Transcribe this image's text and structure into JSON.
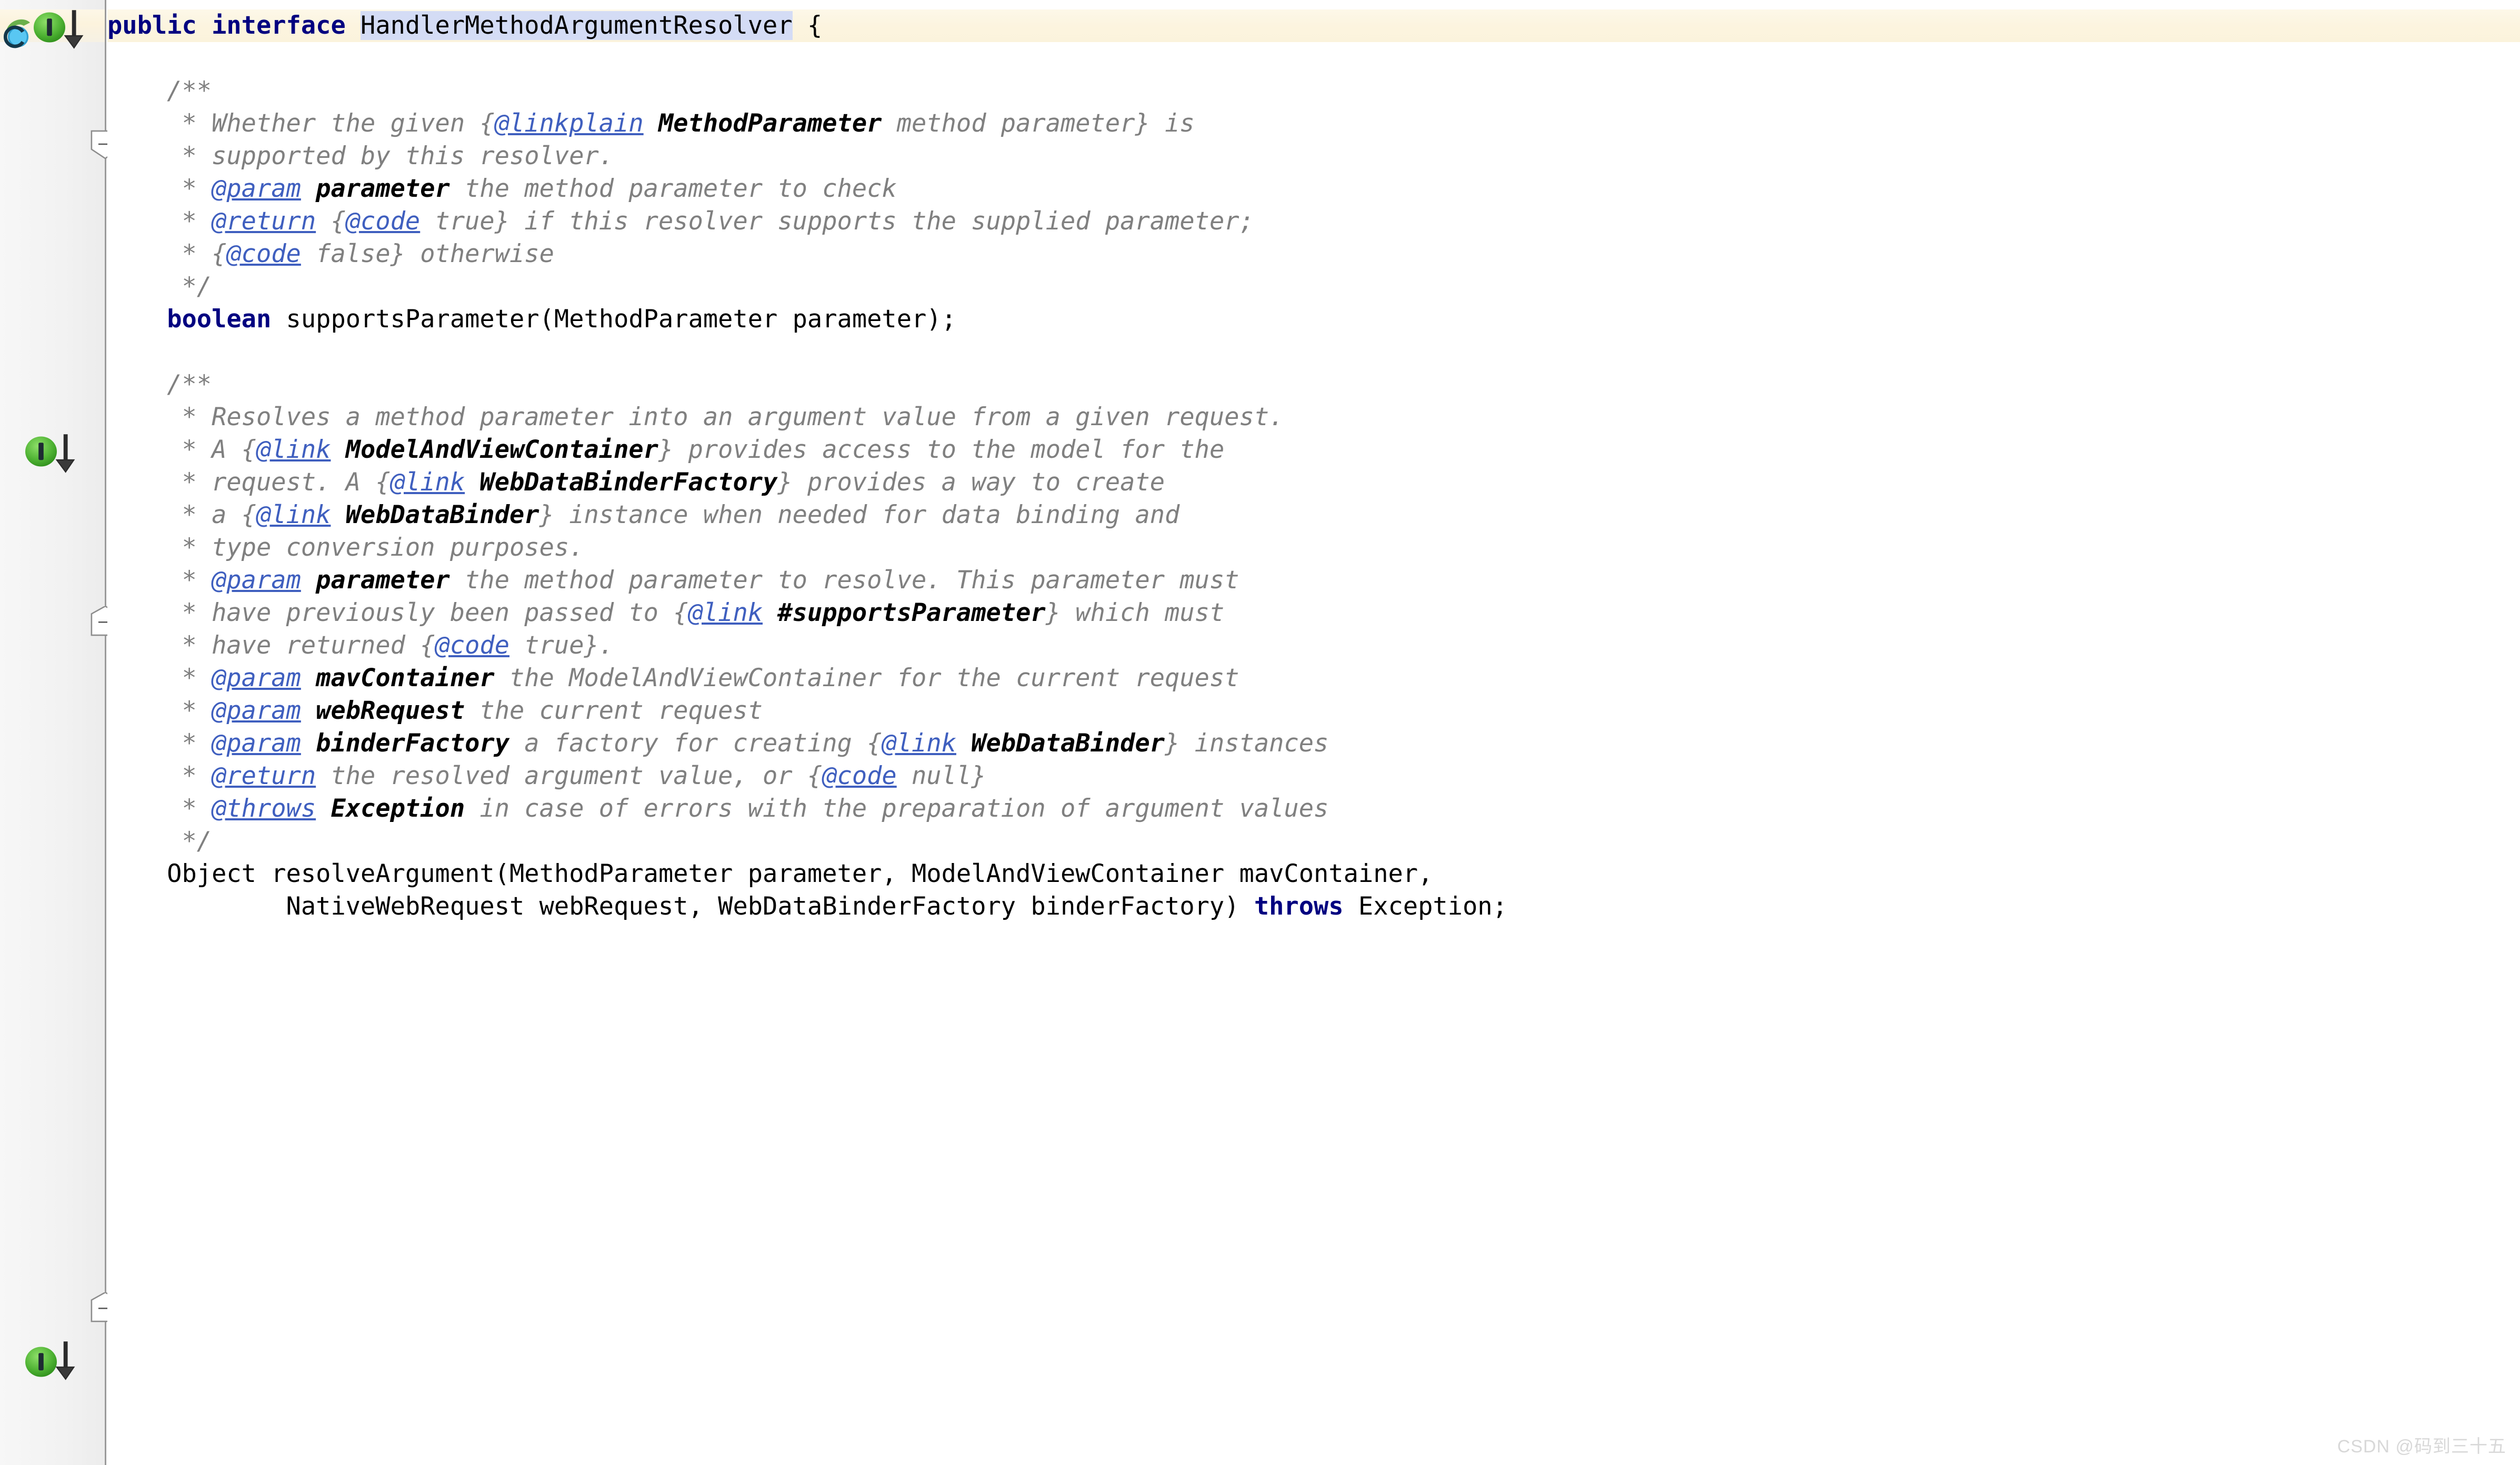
{
  "editor": {
    "app": "IntelliJ IDEA Java Editor",
    "language": "Java",
    "watermark": "CSDN @码到三十五",
    "colors": {
      "keyword": "#000080",
      "comment": "#808080",
      "javadoc_tag": "#3f5fbf",
      "selection": "#d4dcf5",
      "caret_row": "#fcf4df",
      "gutter_bg": "#f2f2f2",
      "implemented_marker": "#4caf50"
    }
  },
  "gutter": {
    "markers": [
      {
        "name": "implemented-method-marker",
        "tooltip": "Is implemented",
        "kind": "green-I-badge",
        "line": 1
      },
      {
        "name": "implemented-method-marker",
        "tooltip": "Is implemented",
        "kind": "green-I-badge",
        "line": 10
      },
      {
        "name": "implemented-method-marker",
        "tooltip": "Is implemented",
        "kind": "green-I-badge",
        "line": 30
      }
    ],
    "folds": [
      {
        "name": "fold-marker-collapse",
        "state": "expanded",
        "line": 3
      },
      {
        "name": "fold-marker-collapse",
        "state": "expanded",
        "line": 12
      },
      {
        "name": "fold-marker-collapse",
        "state": "expanded",
        "line": 29
      }
    ]
  },
  "code": {
    "selected_text": "HandlerMethodArgumentResolver",
    "lines": [
      {
        "id": "line-interface-decl",
        "highlighted": true,
        "indent": 0,
        "tokens": [
          {
            "t": "public",
            "c": "kw"
          },
          {
            "t": " ",
            "c": "plain"
          },
          {
            "t": "interface",
            "c": "kw"
          },
          {
            "t": " ",
            "c": "plain"
          },
          {
            "t": "HandlerMethodArgumentResolver",
            "c": "sel"
          },
          {
            "t": " {",
            "c": "plain"
          }
        ]
      },
      {
        "id": "line-blank-1",
        "tokens": []
      },
      {
        "id": "line-javadoc1-open",
        "tokens": [
          {
            "t": "    /**",
            "c": "cmt"
          }
        ]
      },
      {
        "id": "line-javadoc1-1",
        "tokens": [
          {
            "t": "     * Whether the given {",
            "c": "cmt"
          },
          {
            "t": "@linkplain",
            "c": "tag"
          },
          {
            "t": " ",
            "c": "cmt"
          },
          {
            "t": "MethodParameter",
            "c": "cmt-b"
          },
          {
            "t": " method parameter} is",
            "c": "cmt"
          }
        ]
      },
      {
        "id": "line-javadoc1-2",
        "tokens": [
          {
            "t": "     * supported by this resolver.",
            "c": "cmt"
          }
        ]
      },
      {
        "id": "line-javadoc1-3",
        "tokens": [
          {
            "t": "     * ",
            "c": "cmt"
          },
          {
            "t": "@param",
            "c": "tag"
          },
          {
            "t": " ",
            "c": "cmt"
          },
          {
            "t": "parameter",
            "c": "cmt-b"
          },
          {
            "t": " the method parameter to check",
            "c": "cmt"
          }
        ]
      },
      {
        "id": "line-javadoc1-4",
        "tokens": [
          {
            "t": "     * ",
            "c": "cmt"
          },
          {
            "t": "@return",
            "c": "tag"
          },
          {
            "t": " {",
            "c": "cmt"
          },
          {
            "t": "@code",
            "c": "tag"
          },
          {
            "t": " true} if this resolver supports the supplied parameter;",
            "c": "cmt"
          }
        ]
      },
      {
        "id": "line-javadoc1-5",
        "tokens": [
          {
            "t": "     * {",
            "c": "cmt"
          },
          {
            "t": "@code",
            "c": "tag"
          },
          {
            "t": " false} otherwise",
            "c": "cmt"
          }
        ]
      },
      {
        "id": "line-javadoc1-close",
        "tokens": [
          {
            "t": "     */",
            "c": "cmt"
          }
        ]
      },
      {
        "id": "line-supports-parameter",
        "tokens": [
          {
            "t": "    ",
            "c": "plain"
          },
          {
            "t": "boolean",
            "c": "kw"
          },
          {
            "t": " supportsParameter(MethodParameter parameter);",
            "c": "plain"
          }
        ]
      },
      {
        "id": "line-blank-2",
        "tokens": []
      },
      {
        "id": "line-javadoc2-open",
        "tokens": [
          {
            "t": "    /**",
            "c": "cmt"
          }
        ]
      },
      {
        "id": "line-javadoc2-1",
        "tokens": [
          {
            "t": "     * Resolves a method parameter into an argument value from a given request.",
            "c": "cmt"
          }
        ]
      },
      {
        "id": "line-javadoc2-2",
        "tokens": [
          {
            "t": "     * A {",
            "c": "cmt"
          },
          {
            "t": "@link",
            "c": "tag"
          },
          {
            "t": " ",
            "c": "cmt"
          },
          {
            "t": "ModelAndViewContainer",
            "c": "cmt-b"
          },
          {
            "t": "} provides access to the model for the",
            "c": "cmt"
          }
        ]
      },
      {
        "id": "line-javadoc2-3",
        "tokens": [
          {
            "t": "     * request. A {",
            "c": "cmt"
          },
          {
            "t": "@link",
            "c": "tag"
          },
          {
            "t": " ",
            "c": "cmt"
          },
          {
            "t": "WebDataBinderFactory",
            "c": "cmt-b"
          },
          {
            "t": "} provides a way to create",
            "c": "cmt"
          }
        ]
      },
      {
        "id": "line-javadoc2-4",
        "tokens": [
          {
            "t": "     * a {",
            "c": "cmt"
          },
          {
            "t": "@link",
            "c": "tag"
          },
          {
            "t": " ",
            "c": "cmt"
          },
          {
            "t": "WebDataBinder",
            "c": "cmt-b"
          },
          {
            "t": "} instance when needed for data binding and",
            "c": "cmt"
          }
        ]
      },
      {
        "id": "line-javadoc2-5",
        "tokens": [
          {
            "t": "     * type conversion purposes.",
            "c": "cmt"
          }
        ]
      },
      {
        "id": "line-javadoc2-6",
        "tokens": [
          {
            "t": "     * ",
            "c": "cmt"
          },
          {
            "t": "@param",
            "c": "tag"
          },
          {
            "t": " ",
            "c": "cmt"
          },
          {
            "t": "parameter",
            "c": "cmt-b"
          },
          {
            "t": " the method parameter to resolve. This parameter must",
            "c": "cmt"
          }
        ]
      },
      {
        "id": "line-javadoc2-7",
        "tokens": [
          {
            "t": "     * have previously been passed to {",
            "c": "cmt"
          },
          {
            "t": "@link",
            "c": "tag"
          },
          {
            "t": " ",
            "c": "cmt"
          },
          {
            "t": "#supportsParameter",
            "c": "cmt-b"
          },
          {
            "t": "} which must",
            "c": "cmt"
          }
        ]
      },
      {
        "id": "line-javadoc2-8",
        "tokens": [
          {
            "t": "     * have returned {",
            "c": "cmt"
          },
          {
            "t": "@code",
            "c": "tag"
          },
          {
            "t": " true}.",
            "c": "cmt"
          }
        ]
      },
      {
        "id": "line-javadoc2-9",
        "tokens": [
          {
            "t": "     * ",
            "c": "cmt"
          },
          {
            "t": "@param",
            "c": "tag"
          },
          {
            "t": " ",
            "c": "cmt"
          },
          {
            "t": "mavContainer",
            "c": "cmt-b"
          },
          {
            "t": " the ModelAndViewContainer for the current request",
            "c": "cmt"
          }
        ]
      },
      {
        "id": "line-javadoc2-10",
        "tokens": [
          {
            "t": "     * ",
            "c": "cmt"
          },
          {
            "t": "@param",
            "c": "tag"
          },
          {
            "t": " ",
            "c": "cmt"
          },
          {
            "t": "webRequest",
            "c": "cmt-b"
          },
          {
            "t": " the current request",
            "c": "cmt"
          }
        ]
      },
      {
        "id": "line-javadoc2-11",
        "tokens": [
          {
            "t": "     * ",
            "c": "cmt"
          },
          {
            "t": "@param",
            "c": "tag"
          },
          {
            "t": " ",
            "c": "cmt"
          },
          {
            "t": "binderFactory",
            "c": "cmt-b"
          },
          {
            "t": " a factory for creating {",
            "c": "cmt"
          },
          {
            "t": "@link",
            "c": "tag"
          },
          {
            "t": " ",
            "c": "cmt"
          },
          {
            "t": "WebDataBinder",
            "c": "cmt-b"
          },
          {
            "t": "} instances",
            "c": "cmt"
          }
        ]
      },
      {
        "id": "line-javadoc2-12",
        "tokens": [
          {
            "t": "     * ",
            "c": "cmt"
          },
          {
            "t": "@return",
            "c": "tag"
          },
          {
            "t": " the resolved argument value, or {",
            "c": "cmt"
          },
          {
            "t": "@code",
            "c": "tag"
          },
          {
            "t": " null}",
            "c": "cmt"
          }
        ]
      },
      {
        "id": "line-javadoc2-13",
        "tokens": [
          {
            "t": "     * ",
            "c": "cmt"
          },
          {
            "t": "@throws",
            "c": "tag"
          },
          {
            "t": " ",
            "c": "cmt"
          },
          {
            "t": "Exception",
            "c": "cmt-b"
          },
          {
            "t": " in case of errors with the preparation of argument values",
            "c": "cmt"
          }
        ]
      },
      {
        "id": "line-javadoc2-close",
        "tokens": [
          {
            "t": "     */",
            "c": "cmt"
          }
        ]
      },
      {
        "id": "line-resolve-argument-1",
        "tokens": [
          {
            "t": "    Object resolveArgument(MethodParameter parameter, ModelAndViewContainer mavContainer,",
            "c": "plain"
          }
        ]
      },
      {
        "id": "line-resolve-argument-2",
        "tokens": [
          {
            "t": "            NativeWebRequest webRequest, WebDataBinderFactory binderFactory) ",
            "c": "plain"
          },
          {
            "t": "throws",
            "c": "kw"
          },
          {
            "t": " Exception;",
            "c": "plain"
          }
        ]
      }
    ]
  }
}
